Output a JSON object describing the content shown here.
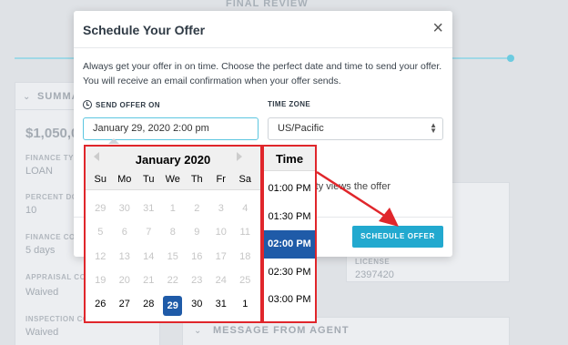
{
  "background": {
    "step_title": "FINAL REVIEW",
    "summary_title": "SUMMA",
    "price": "$1,050,00",
    "fields": [
      {
        "label": "FINANCE TYP",
        "value": "LOAN"
      },
      {
        "label": "PERCENT DO",
        "value": "10"
      },
      {
        "label": "FINANCE CO",
        "value": "5 days"
      },
      {
        "label": "APPRAISAL CO",
        "value": "Waived"
      },
      {
        "label": "INSPECTION CO",
        "value": "Waived"
      }
    ],
    "license_label": "LICENSE",
    "license_value": "2397420",
    "message_title": "MESSAGE FROM AGENT",
    "partial_text": "rty views the offer"
  },
  "modal": {
    "title": "Schedule Your Offer",
    "close_glyph": "×",
    "description": "Always get your offer in on time. Choose the perfect date and time to send your offer. You will receive an email confirmation when your offer sends.",
    "send_label": "SEND OFFER ON",
    "date_value": "January 29, 2020 2:00 pm",
    "timezone_label": "TIME ZONE",
    "timezone_value": "US/Pacific",
    "schedule_button": "SCHEDULE OFFER"
  },
  "calendar": {
    "month_label": "January 2020",
    "days_of_week": [
      "Su",
      "Mo",
      "Tu",
      "We",
      "Th",
      "Fr",
      "Sa"
    ],
    "weeks": [
      [
        "29",
        "30",
        "31",
        "1",
        "2",
        "3",
        "4"
      ],
      [
        "5",
        "6",
        "7",
        "8",
        "9",
        "10",
        "11"
      ],
      [
        "12",
        "13",
        "14",
        "15",
        "16",
        "17",
        "18"
      ],
      [
        "19",
        "20",
        "21",
        "22",
        "23",
        "24",
        "25"
      ],
      [
        "26",
        "27",
        "28",
        "29",
        "30",
        "31",
        "1"
      ]
    ],
    "selected_day": "29"
  },
  "time_picker": {
    "title": "Time",
    "times": [
      "01:00 PM",
      "01:30 PM",
      "02:00 PM",
      "02:30 PM",
      "03:00 PM"
    ],
    "selected": "02:00 PM"
  },
  "colors": {
    "accent": "#22a9cf",
    "selected": "#1f5ba8",
    "annotation": "#e0262b"
  }
}
